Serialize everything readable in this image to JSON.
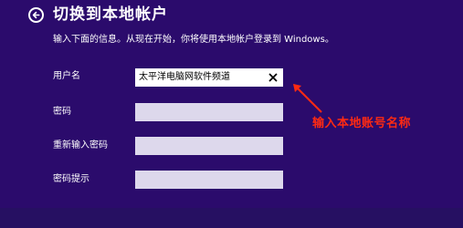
{
  "header": {
    "back_icon": "back-arrow-icon",
    "title": "切换到本地帐户",
    "subtitle": "输入下面的信息。从现在开始，你将使用本地帐户登录到 Windows。"
  },
  "form": {
    "username": {
      "label": "用户名",
      "value": "太平洋电脑网软件频道",
      "clear_icon": "close-icon"
    },
    "password": {
      "label": "密码",
      "value": ""
    },
    "confirm_password": {
      "label": "重新输入密码",
      "value": ""
    },
    "password_hint": {
      "label": "密码提示",
      "value": ""
    }
  },
  "annotation": {
    "text": "输入本地账号名称",
    "color": "#ff2a12"
  },
  "colors": {
    "background": "#2b0b6c",
    "field": "#ddd8ec",
    "active_field": "#ffffff"
  }
}
